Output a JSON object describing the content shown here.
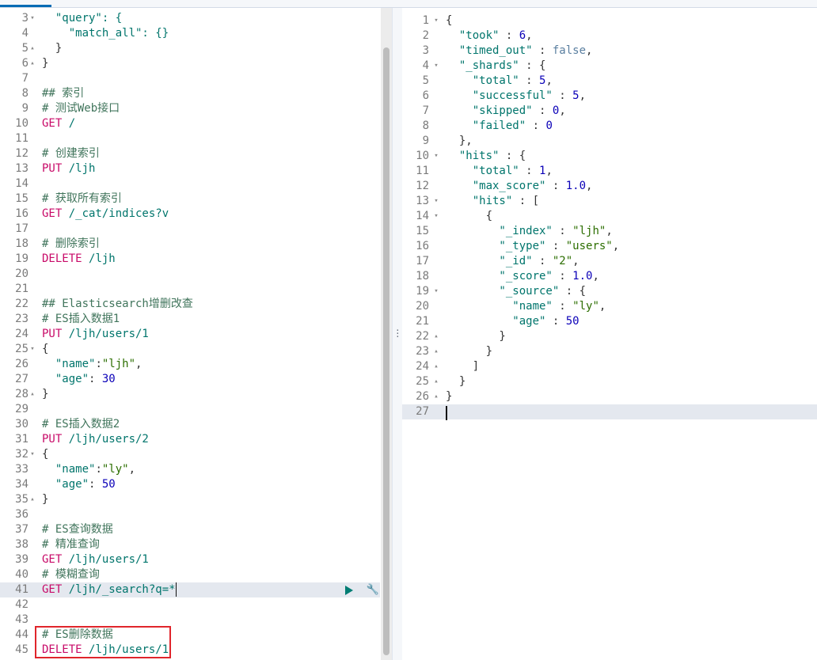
{
  "colors": {
    "comment": "#41755c",
    "method": "#c80a68",
    "url": "#00756c",
    "string": "#2c6e00",
    "number": "#0b00b8",
    "active_line": "#e4e8ef",
    "highlight_box": "#e0252b"
  },
  "request_editor": {
    "lines": [
      {
        "n": "3",
        "fold": "open",
        "parts": [
          {
            "c": "  \"query\": {",
            "t": "key"
          }
        ]
      },
      {
        "n": "4",
        "parts": [
          {
            "c": "    \"match_all\": {}",
            "t": "key"
          }
        ]
      },
      {
        "n": "5",
        "fold": "close",
        "parts": [
          {
            "c": "  }",
            "t": "punct"
          }
        ]
      },
      {
        "n": "6",
        "fold": "close",
        "parts": [
          {
            "c": "}",
            "t": "punct"
          }
        ]
      },
      {
        "n": "7",
        "parts": []
      },
      {
        "n": "8",
        "parts": [
          {
            "c": "## 索引",
            "t": "comment"
          }
        ]
      },
      {
        "n": "9",
        "parts": [
          {
            "c": "# 测试Web接口",
            "t": "comment"
          }
        ]
      },
      {
        "n": "10",
        "parts": [
          {
            "c": "GET ",
            "t": "method"
          },
          {
            "c": "/",
            "t": "url"
          }
        ]
      },
      {
        "n": "11",
        "parts": []
      },
      {
        "n": "12",
        "parts": [
          {
            "c": "# 创建索引",
            "t": "comment"
          }
        ]
      },
      {
        "n": "13",
        "parts": [
          {
            "c": "PUT ",
            "t": "method"
          },
          {
            "c": "/ljh",
            "t": "url"
          }
        ]
      },
      {
        "n": "14",
        "parts": []
      },
      {
        "n": "15",
        "parts": [
          {
            "c": "# 获取所有索引",
            "t": "comment"
          }
        ]
      },
      {
        "n": "16",
        "parts": [
          {
            "c": "GET ",
            "t": "method"
          },
          {
            "c": "/_cat/indices?v",
            "t": "url"
          }
        ]
      },
      {
        "n": "17",
        "parts": []
      },
      {
        "n": "18",
        "parts": [
          {
            "c": "# 删除索引",
            "t": "comment"
          }
        ]
      },
      {
        "n": "19",
        "parts": [
          {
            "c": "DELETE ",
            "t": "method"
          },
          {
            "c": "/ljh",
            "t": "url"
          }
        ]
      },
      {
        "n": "20",
        "parts": []
      },
      {
        "n": "21",
        "parts": []
      },
      {
        "n": "22",
        "parts": [
          {
            "c": "## Elasticsearch增删改查",
            "t": "comment"
          }
        ]
      },
      {
        "n": "23",
        "parts": [
          {
            "c": "# ES插入数据1",
            "t": "comment"
          }
        ]
      },
      {
        "n": "24",
        "parts": [
          {
            "c": "PUT ",
            "t": "method"
          },
          {
            "c": "/ljh/users/1",
            "t": "url"
          }
        ]
      },
      {
        "n": "25",
        "fold": "open",
        "parts": [
          {
            "c": "{",
            "t": "punct"
          }
        ]
      },
      {
        "n": "26",
        "parts": [
          {
            "c": "  \"name\"",
            "t": "key"
          },
          {
            "c": ":",
            "t": "punct"
          },
          {
            "c": "\"ljh\"",
            "t": "str"
          },
          {
            "c": ",",
            "t": "punct"
          }
        ]
      },
      {
        "n": "27",
        "parts": [
          {
            "c": "  \"age\"",
            "t": "key"
          },
          {
            "c": ": ",
            "t": "punct"
          },
          {
            "c": "30",
            "t": "num"
          }
        ]
      },
      {
        "n": "28",
        "fold": "close",
        "parts": [
          {
            "c": "}",
            "t": "punct"
          }
        ]
      },
      {
        "n": "29",
        "parts": []
      },
      {
        "n": "30",
        "parts": [
          {
            "c": "# ES插入数据2",
            "t": "comment"
          }
        ]
      },
      {
        "n": "31",
        "parts": [
          {
            "c": "PUT ",
            "t": "method"
          },
          {
            "c": "/ljh/users/2",
            "t": "url"
          }
        ]
      },
      {
        "n": "32",
        "fold": "open",
        "parts": [
          {
            "c": "{",
            "t": "punct"
          }
        ]
      },
      {
        "n": "33",
        "parts": [
          {
            "c": "  \"name\"",
            "t": "key"
          },
          {
            "c": ":",
            "t": "punct"
          },
          {
            "c": "\"ly\"",
            "t": "str"
          },
          {
            "c": ",",
            "t": "punct"
          }
        ]
      },
      {
        "n": "34",
        "parts": [
          {
            "c": "  \"age\"",
            "t": "key"
          },
          {
            "c": ": ",
            "t": "punct"
          },
          {
            "c": "50",
            "t": "num"
          }
        ]
      },
      {
        "n": "35",
        "fold": "close",
        "parts": [
          {
            "c": "}",
            "t": "punct"
          }
        ]
      },
      {
        "n": "36",
        "parts": []
      },
      {
        "n": "37",
        "parts": [
          {
            "c": "# ES查询数据",
            "t": "comment"
          }
        ]
      },
      {
        "n": "38",
        "parts": [
          {
            "c": "# 精准查询",
            "t": "comment"
          }
        ]
      },
      {
        "n": "39",
        "parts": [
          {
            "c": "GET ",
            "t": "method"
          },
          {
            "c": "/ljh/users/1",
            "t": "url"
          }
        ]
      },
      {
        "n": "40",
        "parts": [
          {
            "c": "# 模糊查询",
            "t": "comment"
          }
        ]
      },
      {
        "n": "41",
        "active": true,
        "parts": [
          {
            "c": "GET ",
            "t": "method"
          },
          {
            "c": "/ljh/_search?q=*",
            "t": "url"
          }
        ]
      },
      {
        "n": "42",
        "parts": []
      },
      {
        "n": "43",
        "parts": []
      },
      {
        "n": "44",
        "parts": [
          {
            "c": "# ES删除数据",
            "t": "comment"
          }
        ]
      },
      {
        "n": "45",
        "parts": [
          {
            "c": "DELETE ",
            "t": "method"
          },
          {
            "c": "/ljh/users/1",
            "t": "url"
          }
        ]
      }
    ]
  },
  "response_viewer": {
    "lines": [
      {
        "n": "1",
        "fold": "open",
        "parts": [
          {
            "c": "{",
            "t": "punct"
          }
        ]
      },
      {
        "n": "2",
        "parts": [
          {
            "c": "  \"took\"",
            "t": "key"
          },
          {
            "c": " : ",
            "t": "punct"
          },
          {
            "c": "6",
            "t": "num"
          },
          {
            "c": ",",
            "t": "punct"
          }
        ]
      },
      {
        "n": "3",
        "parts": [
          {
            "c": "  \"timed_out\"",
            "t": "key"
          },
          {
            "c": " : ",
            "t": "punct"
          },
          {
            "c": "false",
            "t": "bool"
          },
          {
            "c": ",",
            "t": "punct"
          }
        ]
      },
      {
        "n": "4",
        "fold": "open",
        "parts": [
          {
            "c": "  \"_shards\"",
            "t": "key"
          },
          {
            "c": " : {",
            "t": "punct"
          }
        ]
      },
      {
        "n": "5",
        "parts": [
          {
            "c": "    \"total\"",
            "t": "key"
          },
          {
            "c": " : ",
            "t": "punct"
          },
          {
            "c": "5",
            "t": "num"
          },
          {
            "c": ",",
            "t": "punct"
          }
        ]
      },
      {
        "n": "6",
        "parts": [
          {
            "c": "    \"successful\"",
            "t": "key"
          },
          {
            "c": " : ",
            "t": "punct"
          },
          {
            "c": "5",
            "t": "num"
          },
          {
            "c": ",",
            "t": "punct"
          }
        ]
      },
      {
        "n": "7",
        "parts": [
          {
            "c": "    \"skipped\"",
            "t": "key"
          },
          {
            "c": " : ",
            "t": "punct"
          },
          {
            "c": "0",
            "t": "num"
          },
          {
            "c": ",",
            "t": "punct"
          }
        ]
      },
      {
        "n": "8",
        "parts": [
          {
            "c": "    \"failed\"",
            "t": "key"
          },
          {
            "c": " : ",
            "t": "punct"
          },
          {
            "c": "0",
            "t": "num"
          }
        ]
      },
      {
        "n": "9",
        "parts": [
          {
            "c": "  },",
            "t": "punct"
          }
        ]
      },
      {
        "n": "10",
        "fold": "open",
        "parts": [
          {
            "c": "  \"hits\"",
            "t": "key"
          },
          {
            "c": " : {",
            "t": "punct"
          }
        ]
      },
      {
        "n": "11",
        "parts": [
          {
            "c": "    \"total\"",
            "t": "key"
          },
          {
            "c": " : ",
            "t": "punct"
          },
          {
            "c": "1",
            "t": "num"
          },
          {
            "c": ",",
            "t": "punct"
          }
        ]
      },
      {
        "n": "12",
        "parts": [
          {
            "c": "    \"max_score\"",
            "t": "key"
          },
          {
            "c": " : ",
            "t": "punct"
          },
          {
            "c": "1.0",
            "t": "num"
          },
          {
            "c": ",",
            "t": "punct"
          }
        ]
      },
      {
        "n": "13",
        "fold": "open",
        "parts": [
          {
            "c": "    \"hits\"",
            "t": "key"
          },
          {
            "c": " : [",
            "t": "punct"
          }
        ]
      },
      {
        "n": "14",
        "fold": "open",
        "parts": [
          {
            "c": "      {",
            "t": "punct"
          }
        ]
      },
      {
        "n": "15",
        "parts": [
          {
            "c": "        \"_index\"",
            "t": "key"
          },
          {
            "c": " : ",
            "t": "punct"
          },
          {
            "c": "\"ljh\"",
            "t": "str"
          },
          {
            "c": ",",
            "t": "punct"
          }
        ]
      },
      {
        "n": "16",
        "parts": [
          {
            "c": "        \"_type\"",
            "t": "key"
          },
          {
            "c": " : ",
            "t": "punct"
          },
          {
            "c": "\"users\"",
            "t": "str"
          },
          {
            "c": ",",
            "t": "punct"
          }
        ]
      },
      {
        "n": "17",
        "parts": [
          {
            "c": "        \"_id\"",
            "t": "key"
          },
          {
            "c": " : ",
            "t": "punct"
          },
          {
            "c": "\"2\"",
            "t": "str"
          },
          {
            "c": ",",
            "t": "punct"
          }
        ]
      },
      {
        "n": "18",
        "parts": [
          {
            "c": "        \"_score\"",
            "t": "key"
          },
          {
            "c": " : ",
            "t": "punct"
          },
          {
            "c": "1.0",
            "t": "num"
          },
          {
            "c": ",",
            "t": "punct"
          }
        ]
      },
      {
        "n": "19",
        "fold": "open",
        "parts": [
          {
            "c": "        \"_source\"",
            "t": "key"
          },
          {
            "c": " : {",
            "t": "punct"
          }
        ]
      },
      {
        "n": "20",
        "parts": [
          {
            "c": "          \"name\"",
            "t": "key"
          },
          {
            "c": " : ",
            "t": "punct"
          },
          {
            "c": "\"ly\"",
            "t": "str"
          },
          {
            "c": ",",
            "t": "punct"
          }
        ]
      },
      {
        "n": "21",
        "parts": [
          {
            "c": "          \"age\"",
            "t": "key"
          },
          {
            "c": " : ",
            "t": "punct"
          },
          {
            "c": "50",
            "t": "num"
          }
        ]
      },
      {
        "n": "22",
        "fold": "close",
        "parts": [
          {
            "c": "        }",
            "t": "punct"
          }
        ]
      },
      {
        "n": "23",
        "fold": "close",
        "parts": [
          {
            "c": "      }",
            "t": "punct"
          }
        ]
      },
      {
        "n": "24",
        "fold": "close",
        "parts": [
          {
            "c": "    ]",
            "t": "punct"
          }
        ]
      },
      {
        "n": "25",
        "fold": "close",
        "parts": [
          {
            "c": "  }",
            "t": "punct"
          }
        ]
      },
      {
        "n": "26",
        "fold": "close",
        "parts": [
          {
            "c": "}",
            "t": "punct"
          }
        ]
      },
      {
        "n": "27",
        "active": true,
        "parts": []
      }
    ]
  },
  "icons": {
    "run": "play-icon",
    "settings": "wrench-icon",
    "resizer": "drag-handle-icon"
  }
}
